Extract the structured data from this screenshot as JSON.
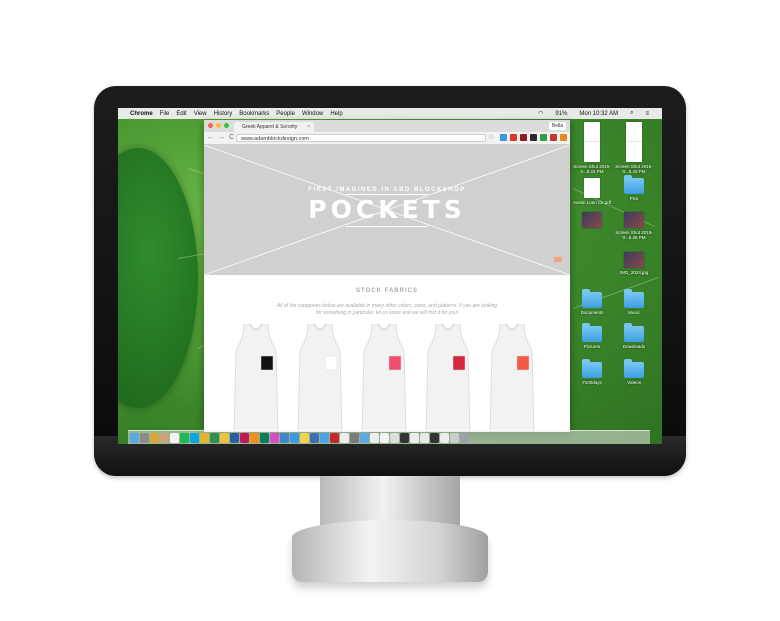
{
  "menubar": {
    "apple": "",
    "items": [
      "Chrome",
      "File",
      "Edit",
      "View",
      "History",
      "Bookmarks",
      "People",
      "Window",
      "Help"
    ],
    "battery": "91%",
    "clock": "Mon 10:32 AM"
  },
  "browser": {
    "tab_title": "Greek Apparel & Sorority",
    "tab_close": "×",
    "user": "Bella",
    "url": "www.adamblockdesign.com",
    "back": "←",
    "forward": "→",
    "reload": "C",
    "bookmark_star": "☆"
  },
  "page": {
    "hero_kicker": "FIRST IMAGINED IN ABD BLOCKSHOP",
    "hero_title": "POCKETS",
    "section_title": "STOCK FABRICS",
    "section_desc": "All of the categories below are available in many other colors, sizes, and patterns. If you are looking for something in particular, let us know and we will find it for you!",
    "products": [
      {
        "name": "black-pocket-tank",
        "pocket_color": "#111111"
      },
      {
        "name": "white-pocket-tank",
        "pocket_color": "#ffffff"
      },
      {
        "name": "pink-pocket-tank",
        "pocket_color": "#ef4f6e"
      },
      {
        "name": "red-pocket-tank",
        "pocket_color": "#d8243c"
      },
      {
        "name": "coral-pocket-tank",
        "pocket_color": "#f05a47"
      }
    ]
  },
  "desktop": {
    "icons": [
      {
        "label": "",
        "kind": "doc"
      },
      {
        "label": "",
        "kind": "doc"
      },
      {
        "label": "Screen Shot 2015-0...6.24 PM",
        "kind": "doc"
      },
      {
        "label": "Screen Shot 2015-0...5.43 PM",
        "kind": "doc"
      },
      {
        "label": "Austin Loan Ck.pdf",
        "kind": "doc"
      },
      {
        "label": "Pics",
        "kind": "folder"
      },
      {
        "label": "",
        "kind": "thumb"
      },
      {
        "label": "Screen Shot 2015-0...5.26 PM",
        "kind": "thumb"
      },
      {
        "label": "IMG_2024.jpg",
        "kind": "thumb"
      },
      {
        "label": "Documents",
        "kind": "folder"
      },
      {
        "label": "Music",
        "kind": "folder"
      },
      {
        "label": "Pictures",
        "kind": "folder"
      },
      {
        "label": "Downloads",
        "kind": "folder"
      },
      {
        "label": "#100days",
        "kind": "folder"
      },
      {
        "label": "Videos",
        "kind": "folder"
      }
    ]
  },
  "dock": {
    "icons": [
      "finder",
      "launchpad",
      "photos",
      "contacts",
      "calendar",
      "spotify",
      "skype",
      "chrome",
      "drive",
      "notes",
      "photoshop",
      "indesign",
      "illustrator",
      "audition",
      "itunes",
      "preview",
      "safari",
      "notes2",
      "keynote",
      "mail",
      "acrobat",
      "text",
      "calculator",
      "finder2",
      "doc1",
      "doc2",
      "doc3",
      "doc4",
      "doc5",
      "doc6",
      "doc7",
      "doc8",
      "doc9",
      "trash"
    ],
    "colors": [
      "#5aa9e6",
      "#8b8b8b",
      "#d9a23a",
      "#c9a47a",
      "#f4f4f4",
      "#1db954",
      "#0ba5e0",
      "#e4b42f",
      "#2f8f4e",
      "#f0c23b",
      "#2c5ea3",
      "#c2185b",
      "#f28c1a",
      "#0a7a5a",
      "#d94ec5",
      "#3e86c6",
      "#3b9ae1",
      "#f4d24a",
      "#3e6fb0",
      "#4aa3e8",
      "#c7262a",
      "#eeeeee",
      "#7b7b7b",
      "#5aa9e6",
      "#eeeeee",
      "#f4f4f4",
      "#dddddd",
      "#333333",
      "#eeeeee",
      "#e9e9e9",
      "#333333",
      "#eeeeee",
      "#cccccc",
      "#9aa3aa"
    ]
  },
  "colors": {
    "hero_bg": "#d0d0d0",
    "accent": "#f2a38b"
  }
}
